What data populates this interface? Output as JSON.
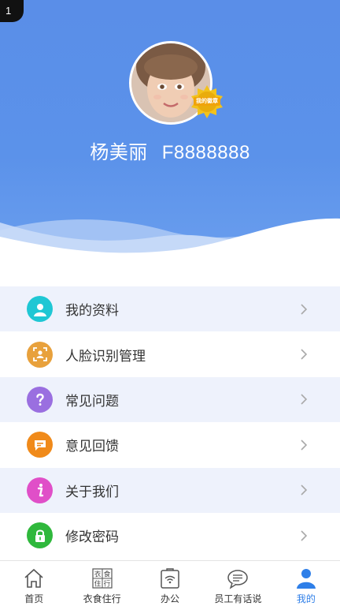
{
  "status": {
    "badge_text": "1"
  },
  "profile": {
    "name": "杨美丽",
    "employee_id": "F8888888",
    "medal_text": "我的徽章"
  },
  "menu": {
    "items": [
      {
        "label": "我的资料",
        "icon": "user-icon",
        "color": "#1fc7d4"
      },
      {
        "label": "人脸识别管理",
        "icon": "face-scan-icon",
        "color": "#e8a13c"
      },
      {
        "label": "常见问题",
        "icon": "question-icon",
        "color": "#9a6fe0"
      },
      {
        "label": "意见回馈",
        "icon": "chat-icon",
        "color": "#f08a1a"
      },
      {
        "label": "关于我们",
        "icon": "info-icon",
        "color": "#e04fc8"
      },
      {
        "label": "修改密码",
        "icon": "lock-icon",
        "color": "#2fb83c"
      }
    ]
  },
  "tabbar": {
    "tabs": [
      {
        "label": "首页",
        "icon": "home-icon",
        "active": false
      },
      {
        "label": "衣食住行",
        "icon": "lifestyle-grid-icon",
        "icon_chars": [
          "衣",
          "食",
          "住",
          "行"
        ],
        "active": false
      },
      {
        "label": "办公",
        "icon": "office-wifi-icon",
        "active": false
      },
      {
        "label": "员工有话说",
        "icon": "speech-bubble-icon",
        "active": false
      },
      {
        "label": "我的",
        "icon": "person-icon",
        "active": true
      }
    ]
  },
  "colors": {
    "header_blue": "#5b92ea",
    "active_tab": "#2f7fe8",
    "menu_alt_bg": "#eef2fc"
  }
}
